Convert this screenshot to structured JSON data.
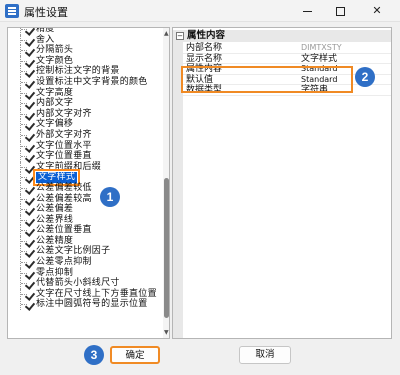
{
  "window": {
    "title": "属性设置",
    "controls": {
      "minimize": "—",
      "maximize": "",
      "close": "✕"
    }
  },
  "tree": {
    "items": [
      {
        "label": "精度",
        "selected": false
      },
      {
        "label": "舍入",
        "selected": false
      },
      {
        "label": "分隔箭头",
        "selected": false
      },
      {
        "label": "文字颜色",
        "selected": false
      },
      {
        "label": "控制标注文字的背景",
        "selected": false
      },
      {
        "label": "设置标注中文字背景的颜色",
        "selected": false
      },
      {
        "label": "文字高度",
        "selected": false
      },
      {
        "label": "内部文字",
        "selected": false
      },
      {
        "label": "内部文字对齐",
        "selected": false
      },
      {
        "label": "文字偏移",
        "selected": false
      },
      {
        "label": "外部文字对齐",
        "selected": false
      },
      {
        "label": "文字位置水平",
        "selected": false
      },
      {
        "label": "文字位置垂直",
        "selected": false
      },
      {
        "label": "文字前缀和后缀",
        "selected": false
      },
      {
        "label": "文字样式",
        "selected": true
      },
      {
        "label": "公差偏差较低",
        "selected": false
      },
      {
        "label": "公差偏差较高",
        "selected": false
      },
      {
        "label": "公差偏差",
        "selected": false
      },
      {
        "label": "公差界线",
        "selected": false
      },
      {
        "label": "公差位置垂直",
        "selected": false
      },
      {
        "label": "公差精度",
        "selected": false
      },
      {
        "label": "公差文字比例因子",
        "selected": false
      },
      {
        "label": "公差零点抑制",
        "selected": false
      },
      {
        "label": "零点抑制",
        "selected": false
      },
      {
        "label": "代替箭头小斜线尺寸",
        "selected": false
      },
      {
        "label": "文字在尺寸线上下方垂直位置",
        "selected": false
      },
      {
        "label": "标注中圆弧符号的显示位置",
        "selected": false
      }
    ]
  },
  "properties": {
    "header": "属性内容",
    "toggle": "−",
    "rows": [
      {
        "name": "内部名称",
        "value": "DIMTXSTY",
        "muted": true,
        "zh": false
      },
      {
        "name": "显示名称",
        "value": "文字样式",
        "muted": false,
        "zh": true
      },
      {
        "name": "属性内容",
        "value": "Standard",
        "muted": false,
        "zh": false
      },
      {
        "name": "默认值",
        "value": "Standard",
        "muted": false,
        "zh": false
      },
      {
        "name": "数据类型",
        "value": "字符串",
        "muted": false,
        "zh": true
      }
    ]
  },
  "callouts": {
    "one": "1",
    "two": "2",
    "three": "3"
  },
  "buttons": {
    "ok": "确定",
    "cancel": "取消"
  },
  "colors": {
    "accent": "#2f6fc6",
    "highlight": "#f08a24",
    "selection": "#0a5fd4"
  }
}
